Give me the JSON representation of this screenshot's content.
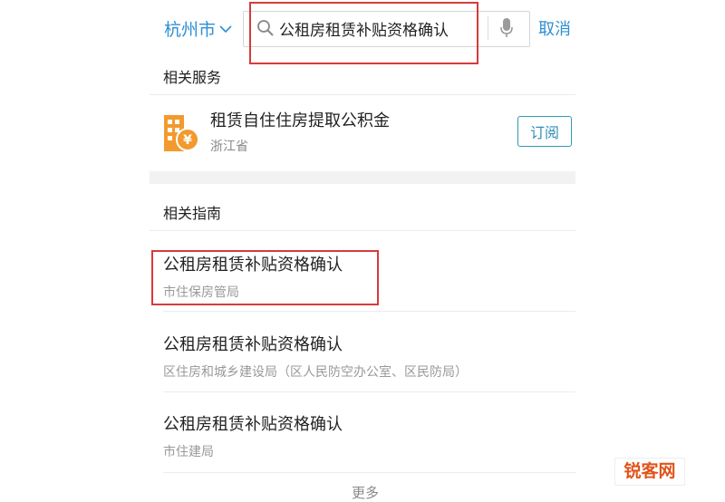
{
  "header": {
    "city": "杭州市",
    "search_value": "公租房租赁补贴资格确认",
    "cancel_label": "取消"
  },
  "related_services": {
    "title": "相关服务",
    "item": {
      "title": "租赁自住住房提取公积金",
      "region": "浙江省",
      "subscribe_label": "订阅",
      "icon": "building-yuan-icon"
    }
  },
  "related_guides": {
    "title": "相关指南",
    "items": [
      {
        "title": "公租房租赁补贴资格确认",
        "department": "市住保房管局"
      },
      {
        "title": "公租房租赁补贴资格确认",
        "department": "区住房和城乡建设局（区人民防空办公室、区民防局）"
      },
      {
        "title": "公租房租赁补贴资格确认",
        "department": "市住建局"
      }
    ],
    "more_label": "更多"
  },
  "watermark": "锐客网",
  "colors": {
    "accent": "#2f8fd3",
    "highlight": "#d63b3b",
    "icon_orange": "#f29a2e"
  }
}
